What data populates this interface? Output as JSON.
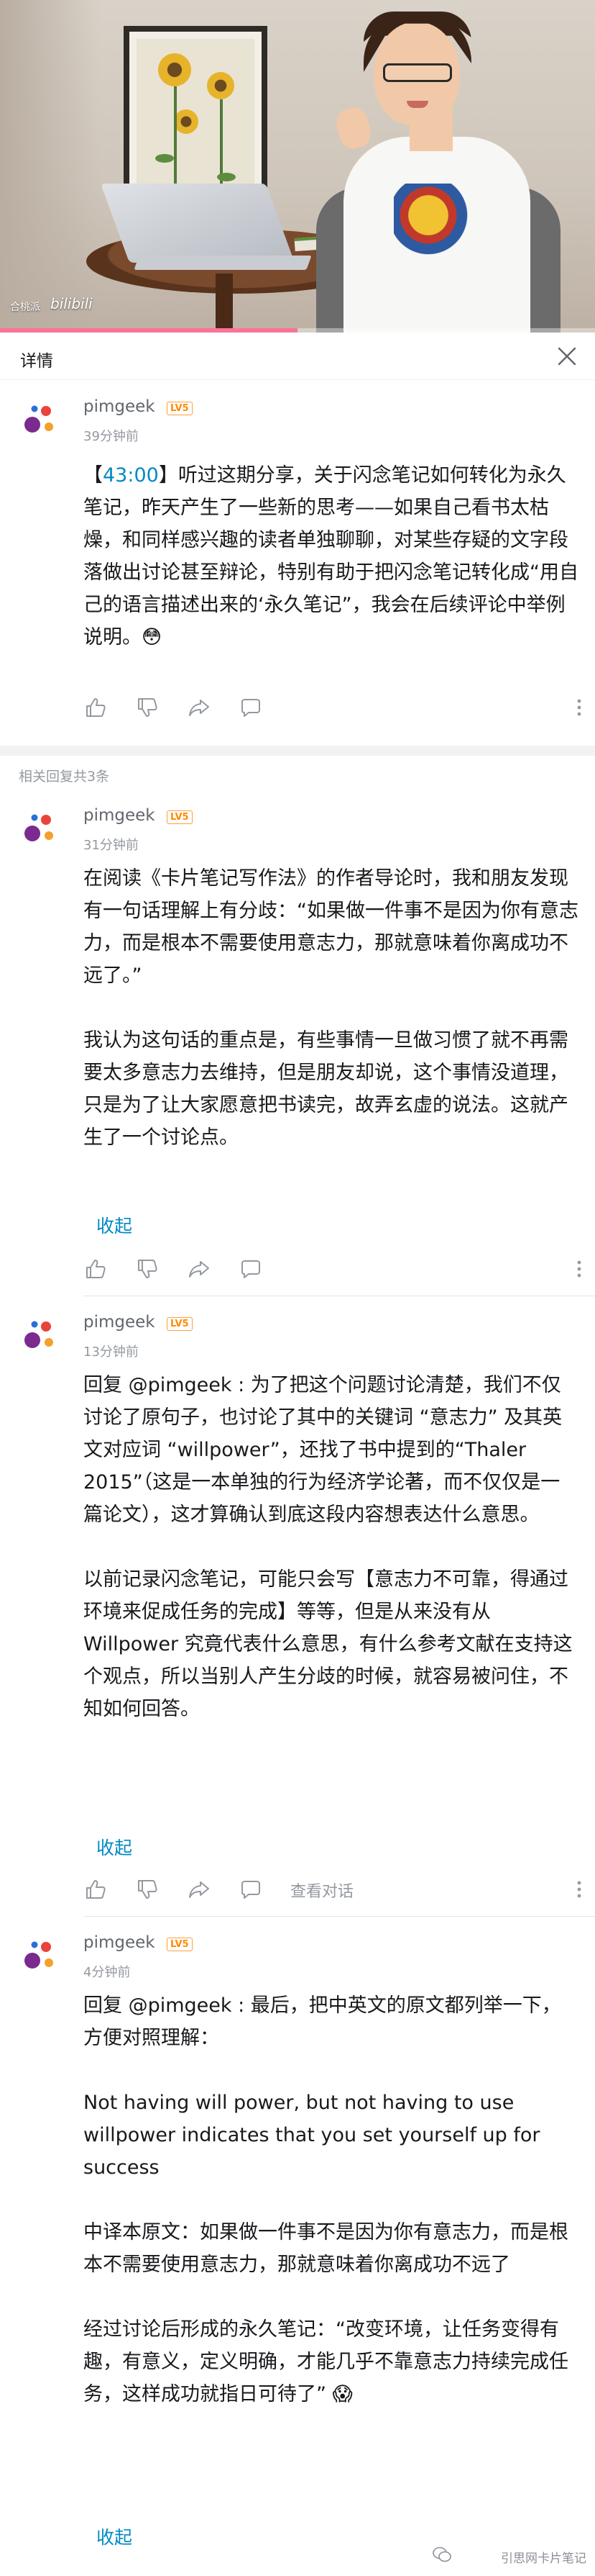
{
  "video": {
    "watermark_text": "合桃派",
    "watermark_logo": "bilibili",
    "progress": 0.5
  },
  "header": {
    "title": "详情"
  },
  "comments": [
    {
      "user": "pimgeek",
      "level": "LV5",
      "time": "39分钟前",
      "timestamp_link": "43:00",
      "text_after_link": "听过这期分享，关于闪念笔记如何转化为永久笔记，昨天产生了一些新的思考——如果自己看书太枯燥，和同样感兴趣的读者单独聊聊，对某些存疑的文字段落做出讨论甚至辩论，特别有助于把闪念笔记转化成“用自己的语言描述出来的‘永久笔记”，我会在后续评论中举例说明。😳"
    }
  ],
  "replies_header": "相关回复共3条",
  "replies": [
    {
      "user": "pimgeek",
      "level": "LV5",
      "time": "31分钟前",
      "paragraphs": [
        "在阅读《卡片笔记写作法》的作者导论时，我和朋友发现有一句话理解上有分歧：“如果做一件事不是因为你有意志力，而是根本不需要使用意志力，那就意味着你离成功不远了。”",
        "我认为这句话的重点是，有些事情一旦做习惯了就不再需要太多意志力去维持，但是朋友却说，这个事情没道理，只是为了让大家愿意把书读完，故弄玄虚的说法。这就产生了一个讨论点。"
      ],
      "fold_label": "收起"
    },
    {
      "user": "pimgeek",
      "level": "LV5",
      "time": "13分钟前",
      "paragraphs": [
        "回复 @pimgeek : 为了把这个问题讨论清楚，我们不仅讨论了原句子，也讨论了其中的关键词 “意志力” 及其英文对应词 “willpower”，还找了书中提到的“Thaler 2015”（这是一本单独的行为经济学论著，而不仅仅是一篇论文），这才算确认到底这段内容想表达什么意思。",
        "以前记录闪念笔记，可能只会写【意志力不可靠，得通过环境来促成任务的完成】等等，但是从来没有从 Willpower 究竟代表什么意思，有什么参考文献在支持这个观点，所以当别人产生分歧的时候，就容易被问住，不知如何回答。"
      ],
      "fold_label": "收起",
      "view_conversation": "查看对话"
    },
    {
      "user": "pimgeek",
      "level": "LV5",
      "time": "4分钟前",
      "paragraphs": [
        "回复 @pimgeek : 最后，把中英文的原文都列举一下，方便对照理解：",
        "Not having will power, but not having to use willpower indicates that you set yourself up for success",
        "中译本原文：如果做一件事不是因为你有意志力，而是根本不需要使用意志力，那就意味着你离成功不远了",
        "经过讨论后形成的永久笔记：“改变环境，让任务变得有趣，有意义，定义明确，才能几乎不靠意志力持续完成任务，这样成功就指日可待了” 😱"
      ],
      "fold_label": "收起"
    }
  ],
  "footer_watermark": "引思网卡片笔记",
  "colors": {
    "link": "#008ac5",
    "level_badge": "#ff8a00",
    "progress": "#fb7299"
  }
}
